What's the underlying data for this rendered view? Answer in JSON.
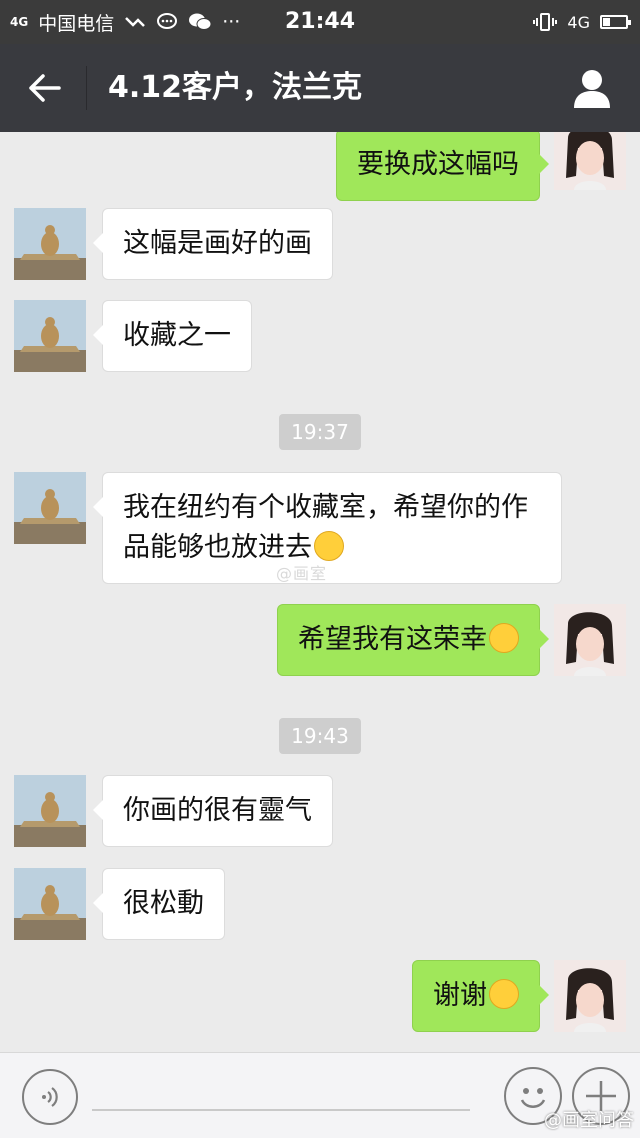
{
  "status_bar": {
    "network": "4G",
    "carrier": "中国电信",
    "time": "21:44",
    "network_right": "4G",
    "battery_level": 0.3
  },
  "nav": {
    "title": "4.12客户，法兰克"
  },
  "messages": [
    {
      "type": "out",
      "text": "要换成这幅吗"
    },
    {
      "type": "in",
      "text": "这幅是画好的画"
    },
    {
      "type": "in",
      "text": "收藏之一"
    },
    {
      "type": "time",
      "text": "19:37"
    },
    {
      "type": "in",
      "text": "我在纽约有个收藏室，希望你的作",
      "text2": "品能够也放进去"
    },
    {
      "type": "out",
      "text": "希望我有这荣幸"
    },
    {
      "type": "time",
      "text": "19:43"
    },
    {
      "type": "in",
      "text": "你画的很有靈气"
    },
    {
      "type": "in",
      "text": "很松動"
    },
    {
      "type": "out",
      "text": "谢谢"
    }
  ],
  "watermark": "@画室",
  "corner_watermark": "@画室问答",
  "icons": {
    "back": "back-arrow-icon",
    "profile": "profile-icon",
    "voice": "voice-icon",
    "emoji": "emoji-icon",
    "plus": "plus-icon"
  },
  "colors": {
    "navbar": "#393a3f",
    "outgoing_bubble": "#a0e75a",
    "incoming_bubble": "#ffffff",
    "chat_bg": "#ebebeb"
  }
}
